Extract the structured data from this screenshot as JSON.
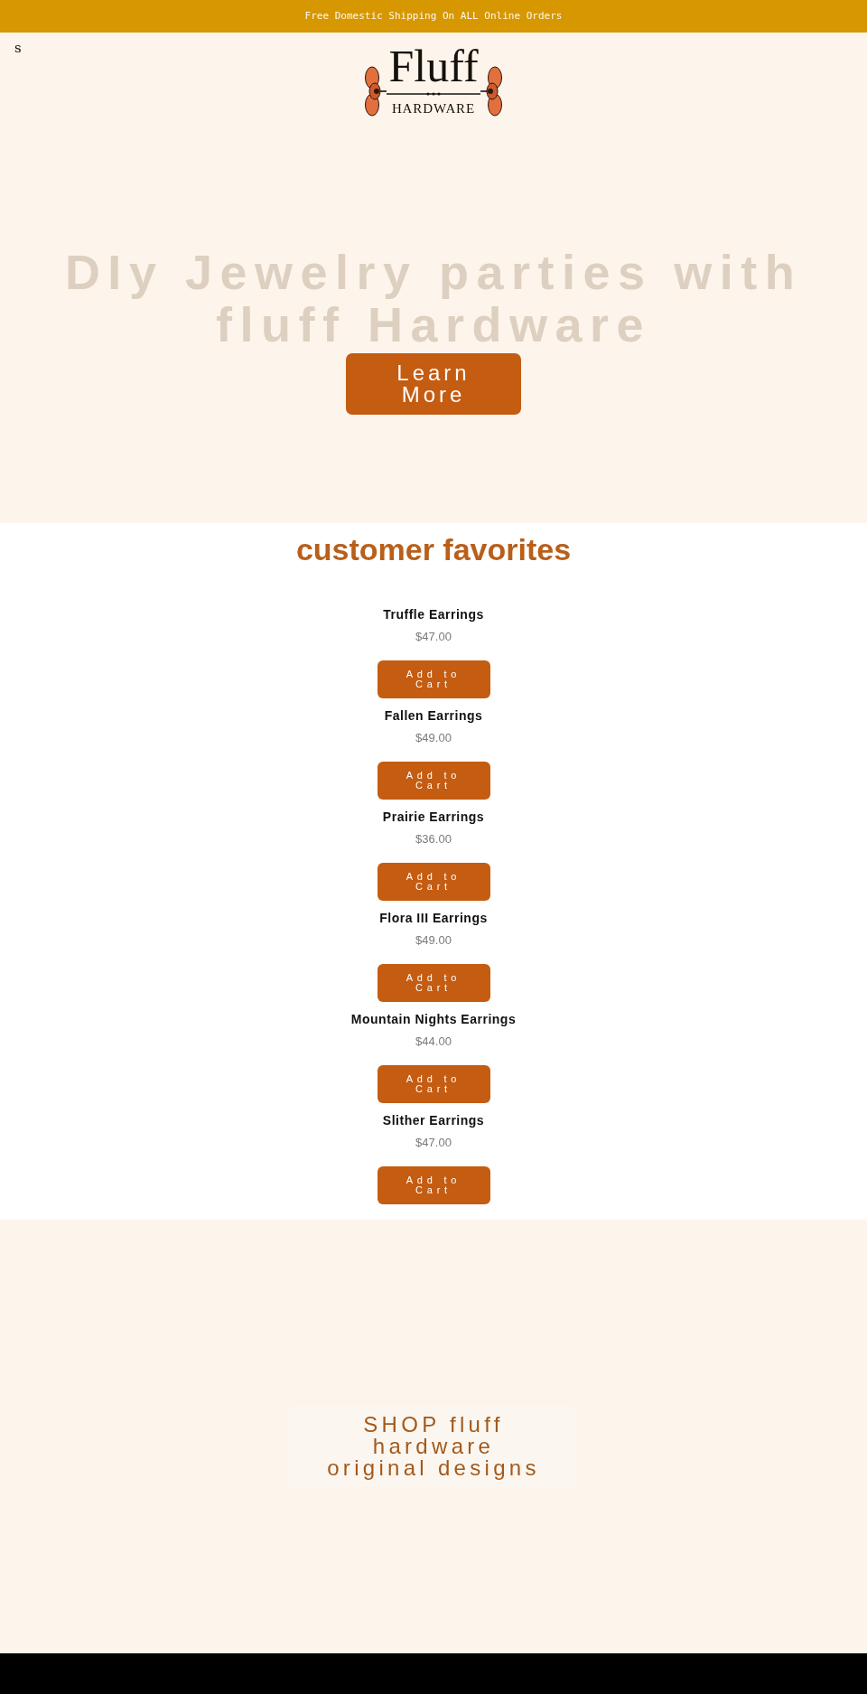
{
  "announcement_bar": {
    "text": "Free Domestic Shipping On ALL Online Orders"
  },
  "header": {
    "menu_label": "s",
    "logo": {
      "title": "Fluff",
      "subtitle": "HARDWARE"
    }
  },
  "hero": {
    "heading": "DIy Jewelry parties with fluff Hardware",
    "button": "Learn More"
  },
  "favorites": {
    "heading": "customer favorites",
    "products": [
      {
        "name": "Truffle Earrings",
        "price": "$47.00",
        "button": "Add to Cart"
      },
      {
        "name": "Fallen Earrings",
        "price": "$49.00",
        "button": "Add to Cart"
      },
      {
        "name": "Prairie Earrings",
        "price": "$36.00",
        "button": "Add to Cart"
      },
      {
        "name": "Flora III Earrings",
        "price": "$49.00",
        "button": "Add to Cart"
      },
      {
        "name": "Mountain Nights Earrings",
        "price": "$44.00",
        "button": "Add to Cart"
      },
      {
        "name": "Slither Earrings",
        "price": "$47.00",
        "button": "Add to Cart"
      }
    ]
  },
  "shop_banner": {
    "button": "SHOP fluff hardware original designs"
  }
}
